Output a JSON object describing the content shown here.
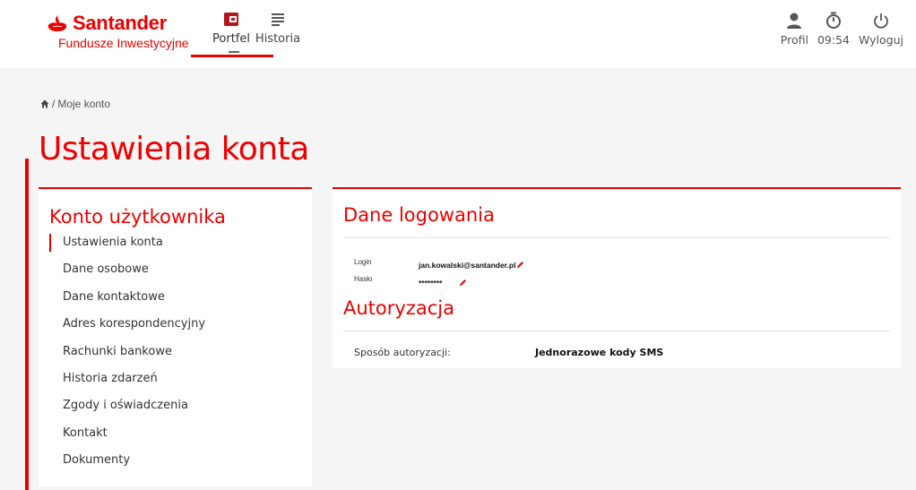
{
  "header": {
    "brand_name": "Santander",
    "brand_subtitle": "Fundusze Inwestycyjne",
    "nav": [
      {
        "label": "Portfel",
        "icon": "wallet-icon",
        "active": true
      },
      {
        "label": "Historia",
        "icon": "list-icon",
        "active": false
      }
    ],
    "right": {
      "profile_label": "Profil",
      "timer_label": "09:54",
      "logout_label": "Wyloguj"
    }
  },
  "breadcrumb": {
    "home_icon": "home-icon",
    "separator": "/",
    "current": "Moje konto"
  },
  "page_title": "Ustawienia konta",
  "sidebar": {
    "title": "Konto użytkownika",
    "items": [
      {
        "label": "Ustawienia konta",
        "active": true
      },
      {
        "label": "Dane osobowe"
      },
      {
        "label": "Dane kontaktowe"
      },
      {
        "label": "Adres korespondencyjny"
      },
      {
        "label": "Rachunki bankowe"
      },
      {
        "label": "Historia zdarzeń"
      },
      {
        "label": "Zgody i oświadczenia"
      },
      {
        "label": "Kontakt"
      },
      {
        "label": "Dokumenty"
      }
    ]
  },
  "login_section": {
    "title": "Dane logowania",
    "login_label": "Login",
    "login_value": "jan.kowalski@santander.pl",
    "password_label": "Hasło",
    "password_value": "********"
  },
  "auth_section": {
    "title": "Autoryzacja",
    "method_label": "Sposób autoryzacji:",
    "method_value": "Jednorazowe kody SMS"
  },
  "colors": {
    "brand": "#ec0000",
    "background": "#f5f5f5",
    "card": "#ffffff"
  }
}
